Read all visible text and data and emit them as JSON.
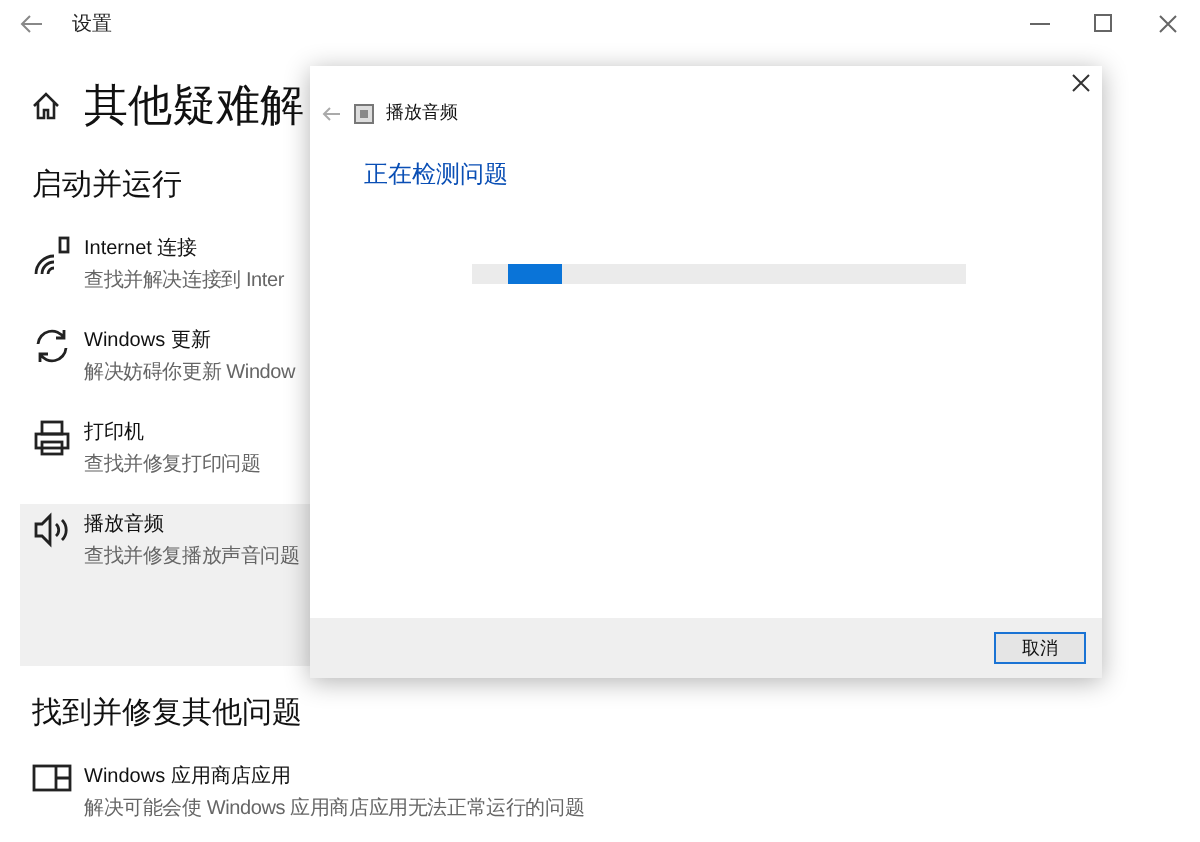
{
  "window": {
    "title": "设置"
  },
  "page": {
    "title": "其他疑难解"
  },
  "sections": [
    {
      "heading": "启动并运行",
      "items": [
        {
          "kind": "wifi",
          "title": "Internet 连接",
          "description": "查找并解决连接到 Inter",
          "selected": false
        },
        {
          "kind": "update",
          "title": "Windows 更新",
          "description": "解决妨碍你更新 Window",
          "selected": false
        },
        {
          "kind": "printer",
          "title": "打印机",
          "description": "查找并修复打印问题",
          "selected": false
        },
        {
          "kind": "speaker",
          "title": "播放音频",
          "description": "查找并修复播放声音问题",
          "selected": true
        }
      ]
    },
    {
      "heading": "找到并修复其他问题",
      "items": [
        {
          "kind": "store",
          "title": "Windows 应用商店应用",
          "description": "解决可能会使 Windows 应用商店应用无法正常运行的问题",
          "selected": false
        }
      ]
    }
  ],
  "dialog": {
    "title": "播放音频",
    "heading": "正在检测问题",
    "progress": {
      "level": 0.11
    },
    "cancel_button": "取消"
  }
}
